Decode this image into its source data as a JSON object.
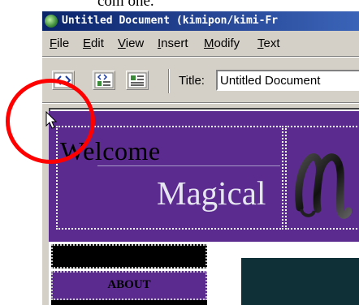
{
  "top_text": "com one.",
  "window": {
    "title": "Untitled Document (kimipon/kimi-Fr"
  },
  "menu": {
    "items": [
      "File",
      "Edit",
      "View",
      "Insert",
      "Modify",
      "Text"
    ]
  },
  "toolbar": {
    "buttons": [
      {
        "icon": "code-view-icon"
      },
      {
        "icon": "split-view-icon"
      },
      {
        "icon": "design-view-icon"
      }
    ],
    "title_label": "Title:",
    "title_value": "Untitled Document"
  },
  "page": {
    "welcome_text": "Welcome",
    "magical_text": "Magical",
    "logo_letter": "M",
    "nav_about": "ABOUT"
  },
  "colors": {
    "header_purple": "#5b2b90",
    "content_dark_teal": "#0e3036",
    "highlight_circle": "#ff0000",
    "titlebar_blue": "#0a246a"
  }
}
